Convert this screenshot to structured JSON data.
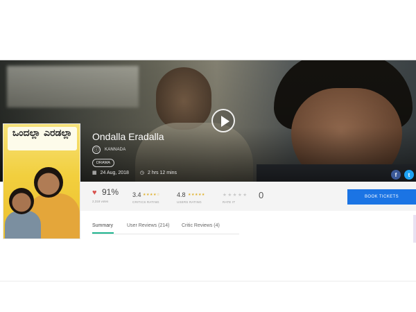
{
  "movie": {
    "title": "Ondalla Eradalla",
    "language": "KANNADA",
    "language_icon": "language-icon",
    "genre": "DRAMA",
    "release_date": "24 Aug, 2018",
    "duration": "2 hrs 12 mins",
    "poster_title": "ಒಂದಲ್ಲಾ ಎರಡಲ್ಲಾ"
  },
  "ratings": {
    "audience_percent": "91%",
    "votes": "2,318 votes",
    "critics_value": "3.4",
    "critics_stars": "★★★★☆",
    "critics_caption": "CRITICS RATING",
    "users_value": "4.8",
    "users_stars": "★★★★★",
    "users_caption": "USERS RATING",
    "rate_stars": "★★★★★",
    "rate_caption": "RATE IT",
    "rate_value": "0"
  },
  "actions": {
    "book_label": "BOOK TICKETS"
  },
  "social": {
    "facebook": "f",
    "twitter": "t"
  },
  "tabs": [
    {
      "label": "Summary",
      "active": true
    },
    {
      "label": "User Reviews (214)",
      "active": false
    },
    {
      "label": "Critic Reviews (4)",
      "active": false
    }
  ],
  "colors": {
    "accent": "#1b74e4",
    "active_tab": "#1fb58f",
    "heart": "#d9534f",
    "star": "#e0b22e"
  }
}
